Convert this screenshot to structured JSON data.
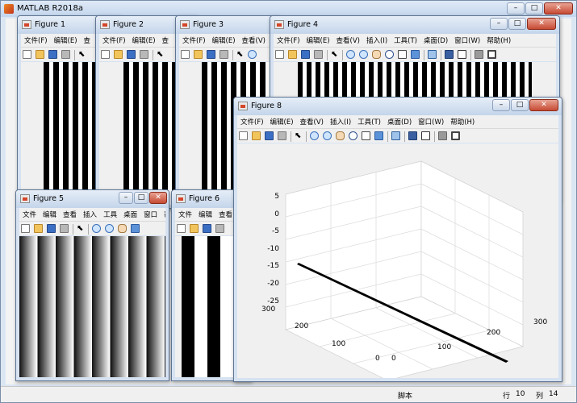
{
  "app": {
    "title": "MATLAB R2018a",
    "status_script": "脚本",
    "status_row_label": "行",
    "status_row": "10",
    "status_col_label": "列",
    "status_col": "14"
  },
  "menus_full": [
    "文件(F)",
    "编辑(E)",
    "查看(V)",
    "插入(I)",
    "工具(T)",
    "桌面(D)",
    "窗口(W)",
    "帮助(H)"
  ],
  "menus_short": [
    "文件",
    "编辑",
    "查看",
    "插入",
    "工具",
    "桌面",
    "窗口",
    "帮助"
  ],
  "windows": {
    "fig1": {
      "title": "Figure 1"
    },
    "fig2": {
      "title": "Figure 2"
    },
    "fig3": {
      "title": "Figure 3"
    },
    "fig4": {
      "title": "Figure 4"
    },
    "fig5": {
      "title": "Figure 5"
    },
    "fig6": {
      "title": "Figure 6"
    },
    "fig8": {
      "title": "Figure 8"
    }
  },
  "figure8_plot": {
    "z_ticks": [
      "5",
      "0",
      "-5",
      "-10",
      "-15",
      "-20",
      "-25"
    ],
    "y_ticks": [
      "300",
      "200",
      "100",
      "0"
    ],
    "x_ticks": [
      "0",
      "100",
      "200",
      "300"
    ]
  },
  "chart_data": {
    "type": "line",
    "dimensions": 3,
    "zlim": [
      -25,
      5
    ],
    "xlim": [
      0,
      300
    ],
    "ylim": [
      0,
      300
    ],
    "series": [
      {
        "x": [
          0,
          300
        ],
        "y": [
          300,
          0
        ],
        "z": [
          -1,
          -24
        ]
      }
    ],
    "grid": true
  }
}
